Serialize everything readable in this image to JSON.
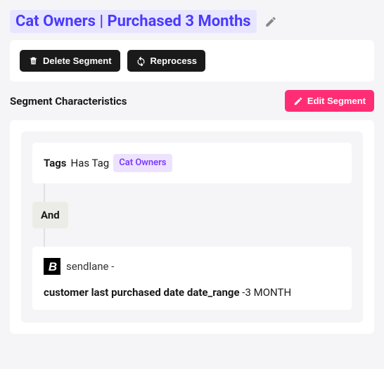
{
  "title": "Cat Owners | Purchased 3 Months",
  "actions": {
    "delete_label": "Delete Segment",
    "reprocess_label": "Reprocess"
  },
  "section": {
    "characteristics_label": "Segment Characteristics",
    "edit_label": "Edit Segment"
  },
  "rules": {
    "connector": "And",
    "rule1": {
      "field": "Tags",
      "operator": "Has Tag",
      "tag_value": "Cat Owners"
    },
    "rule2": {
      "integration_name": "sendlane",
      "integration_suffix": "-",
      "condition_field": "customer last purchased date date_range",
      "condition_value": "-3 MONTH"
    }
  }
}
